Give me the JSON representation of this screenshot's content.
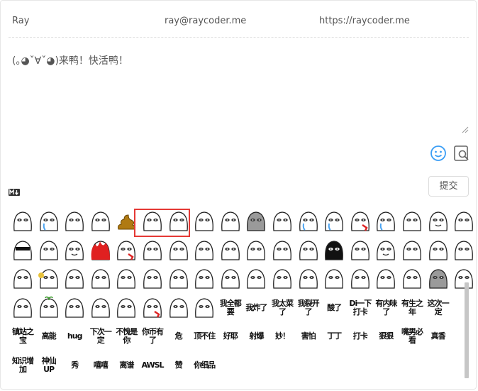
{
  "meta": {
    "nick": "Ray",
    "mail": "ray@raycoder.me",
    "link": "https://raycoder.me"
  },
  "comment": {
    "text": "(｡◕ˇ∀ˇ◕)来鸭！快活鸭！"
  },
  "toolbar": {
    "submit_label": "提交",
    "accent": "#3b9ef5"
  },
  "emoji_rows": [
    [
      "blank-face",
      "crying-face",
      "pointing-gun-face",
      "smug-face",
      "poop",
      "blank-face",
      "yes-face-pair",
      "yes-face-pair",
      "blank-face",
      "grey-ghost-face",
      "wink-face",
      "crying-face",
      "crying-face",
      "bleeding-face",
      "drool-face",
      "dizzy-face",
      "smile-face",
      "glitch-face"
    ],
    [
      "sunglasses-face",
      "sad-face",
      "smile-face",
      "fire-face",
      "bleeding-face",
      "peek-face",
      "flag-face",
      "blank-face",
      "blank-face",
      "thinking-face",
      "sleepy-face",
      "blank-face",
      "black-hood-face",
      "big-eye-face",
      "happy-face",
      "sneaky-face",
      "covered-face",
      "blank-face"
    ],
    [
      "angry-face",
      "flower-face",
      "spray-face",
      "blank-face",
      "cover-face",
      "blank-face",
      "peek-face",
      "blank-face",
      "blank-face",
      "hands-face",
      "puzzled-face",
      "shy-face",
      "candle-face",
      "censored-face",
      "blank-face",
      "blank-face",
      "grey-face",
      "blank-face"
    ],
    [
      "hug-face",
      "sprout-face",
      "peek-face",
      "stare-face",
      "tongue-face",
      "blood-face",
      "scared-face",
      "shout-face",
      "text:我全都要",
      "text:我炸了",
      "text:我太菜了",
      "text:我裂开了",
      "text:酸了",
      "text:Di一下打卡",
      "text:有内味了",
      "text:有生之年",
      "text:这次一定"
    ],
    [
      "text:镇站之宝",
      "text:高能",
      "text:hug",
      "text:下次一定",
      "text:不愧是你",
      "text:你币有了",
      "text:危",
      "text:顶不住",
      "text:好耶",
      "text:射爆",
      "text:妙！",
      "text:害怕",
      "text:丁丁",
      "text:打卡",
      "text:狠狠",
      "text:嘴男必看",
      "text:真香"
    ],
    [
      "text:知识增加",
      "text:神仙UP",
      "text:秀",
      "text:嘻嘻",
      "text:离谱",
      "text:AWSL",
      "text:赞",
      "text:你细品"
    ]
  ]
}
